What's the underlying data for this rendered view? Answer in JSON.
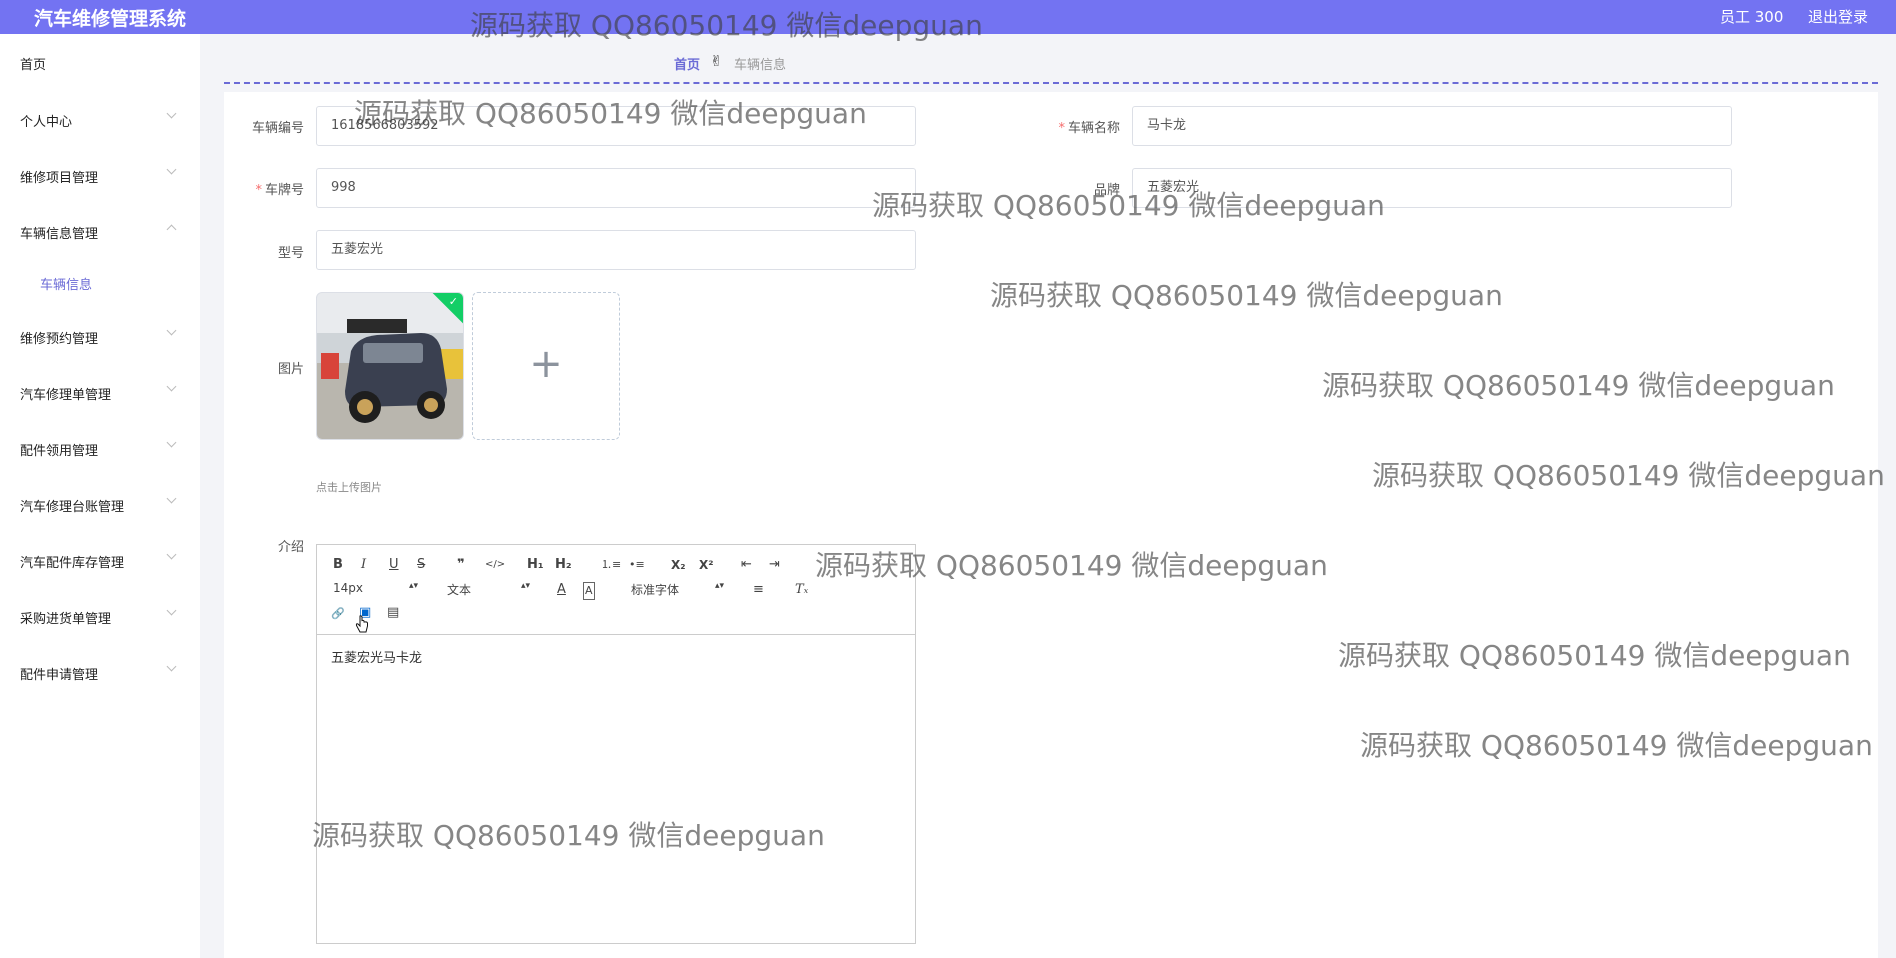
{
  "header": {
    "app_title": "汽车维修管理系统",
    "user_label": "员工 300",
    "logout_label": "退出登录"
  },
  "sidebar": {
    "home": "首页",
    "items": [
      {
        "label": "个人中心",
        "expanded": false
      },
      {
        "label": "维修项目管理",
        "expanded": false
      },
      {
        "label": "车辆信息管理",
        "expanded": true,
        "children": [
          {
            "label": "车辆信息"
          }
        ]
      },
      {
        "label": "维修预约管理",
        "expanded": false
      },
      {
        "label": "汽车修理单管理",
        "expanded": false
      },
      {
        "label": "配件领用管理",
        "expanded": false
      },
      {
        "label": "汽车修理台账管理",
        "expanded": false
      },
      {
        "label": "汽车配件库存管理",
        "expanded": false
      },
      {
        "label": "采购进货单管理",
        "expanded": false
      },
      {
        "label": "配件申请管理",
        "expanded": false
      }
    ]
  },
  "breadcrumb": {
    "home": "首页",
    "current": "车辆信息"
  },
  "form": {
    "vehicle_no": {
      "label": "车辆编号",
      "value": "1618566803592",
      "required": false
    },
    "vehicle_name": {
      "label": "车辆名称",
      "value": "马卡龙",
      "required": true
    },
    "plate_no": {
      "label": "车牌号",
      "value": "998",
      "required": true
    },
    "brand": {
      "label": "品牌",
      "value": "五菱宏光",
      "required": false
    },
    "model": {
      "label": "型号",
      "value": "五菱宏光",
      "required": false
    },
    "image": {
      "label": "图片",
      "upload_tip": "点击上传图片",
      "plus": "+",
      "uploaded_check": "✓"
    },
    "intro": {
      "label": "介绍",
      "content": "五菱宏光马卡龙"
    }
  },
  "editor_toolbar": {
    "bold": "B",
    "italic": "I",
    "underline": "U",
    "strike": "S",
    "blockquote": "❞",
    "code": "</>",
    "h1": "H₁",
    "h2": "H₂",
    "ordered_list": "⒈≡",
    "bullet_list": "•≡",
    "subscript": "X₂",
    "superscript": "X²",
    "outdent": "⇤",
    "indent": "⇥",
    "font_size": "14px",
    "heading_select": "文本",
    "font_family": "标准字体",
    "text_color": "A",
    "bg_color": "A",
    "align": "≡",
    "clean": "Tₓ",
    "link": "🔗",
    "image": "▣",
    "video": "▤"
  },
  "watermark": {
    "text": "源码获取 QQ86050149 微信deepguan"
  },
  "colors": {
    "primary": "#7373f2",
    "accent": "#6b6bd6",
    "required": "#f56c6c",
    "success": "#13ce66"
  }
}
